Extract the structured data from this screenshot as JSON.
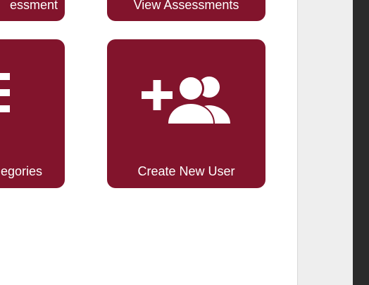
{
  "tiles": {
    "top_left": {
      "label": "essment"
    },
    "top_right": {
      "label": "View Assessments"
    },
    "mid_left": {
      "label": "egories",
      "icon": "list-icon"
    },
    "mid_right": {
      "label": "Create New User",
      "icon": "add-users-icon"
    }
  },
  "colors": {
    "tile_bg": "#82142c",
    "tile_text": "#ffffff",
    "side_panel": "#eeeeee",
    "dark_edge": "#2b2b2b"
  }
}
